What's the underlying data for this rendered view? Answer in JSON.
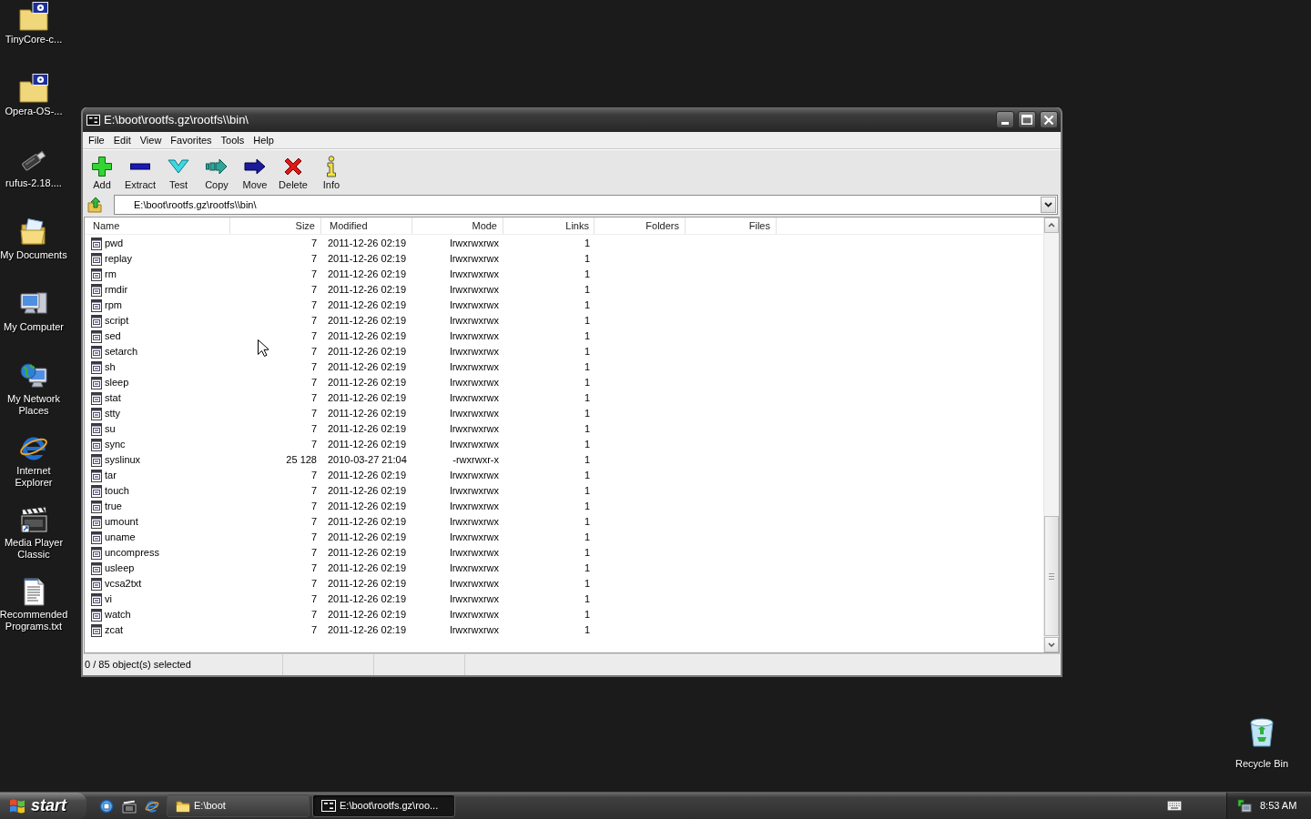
{
  "desktop": {
    "icons": [
      {
        "label": "TinyCore-c...",
        "kind": "iso"
      },
      {
        "label": "Opera-OS-...",
        "kind": "iso"
      },
      {
        "label": "rufus-2.18....",
        "kind": "usb"
      },
      {
        "label": "My Documents",
        "kind": "documents"
      },
      {
        "label": "My Computer",
        "kind": "computer"
      },
      {
        "label": "My Network Places",
        "kind": "network"
      },
      {
        "label": "Internet Explorer",
        "kind": "browser"
      },
      {
        "label": "Media Player Classic",
        "kind": "video"
      },
      {
        "label": "Recommended Programs.txt",
        "kind": "text"
      }
    ],
    "recycle_bin": {
      "label": "Recycle Bin"
    }
  },
  "window": {
    "title": "E:\\boot\\rootfs.gz\\rootfs\\\\bin\\",
    "menu": [
      "File",
      "Edit",
      "View",
      "Favorites",
      "Tools",
      "Help"
    ],
    "toolbar": [
      {
        "label": "Add",
        "kind": "add"
      },
      {
        "label": "Extract",
        "kind": "extract"
      },
      {
        "label": "Test",
        "kind": "test"
      },
      {
        "label": "Copy",
        "kind": "copy"
      },
      {
        "label": "Move",
        "kind": "move"
      },
      {
        "label": "Delete",
        "kind": "delete"
      },
      {
        "label": "Info",
        "kind": "info"
      }
    ],
    "address": {
      "value": "E:\\boot\\rootfs.gz\\rootfs\\\\bin\\"
    },
    "table": {
      "columns": [
        "Name",
        "Size",
        "Modified",
        "Mode",
        "Links",
        "Folders",
        "Files"
      ],
      "rows": [
        [
          "pwd",
          "7",
          "2011-12-26 02:19",
          "lrwxrwxrwx",
          "1"
        ],
        [
          "replay",
          "7",
          "2011-12-26 02:19",
          "lrwxrwxrwx",
          "1"
        ],
        [
          "rm",
          "7",
          "2011-12-26 02:19",
          "lrwxrwxrwx",
          "1"
        ],
        [
          "rmdir",
          "7",
          "2011-12-26 02:19",
          "lrwxrwxrwx",
          "1"
        ],
        [
          "rpm",
          "7",
          "2011-12-26 02:19",
          "lrwxrwxrwx",
          "1"
        ],
        [
          "script",
          "7",
          "2011-12-26 02:19",
          "lrwxrwxrwx",
          "1"
        ],
        [
          "sed",
          "7",
          "2011-12-26 02:19",
          "lrwxrwxrwx",
          "1"
        ],
        [
          "setarch",
          "7",
          "2011-12-26 02:19",
          "lrwxrwxrwx",
          "1"
        ],
        [
          "sh",
          "7",
          "2011-12-26 02:19",
          "lrwxrwxrwx",
          "1"
        ],
        [
          "sleep",
          "7",
          "2011-12-26 02:19",
          "lrwxrwxrwx",
          "1"
        ],
        [
          "stat",
          "7",
          "2011-12-26 02:19",
          "lrwxrwxrwx",
          "1"
        ],
        [
          "stty",
          "7",
          "2011-12-26 02:19",
          "lrwxrwxrwx",
          "1"
        ],
        [
          "su",
          "7",
          "2011-12-26 02:19",
          "lrwxrwxrwx",
          "1"
        ],
        [
          "sync",
          "7",
          "2011-12-26 02:19",
          "lrwxrwxrwx",
          "1"
        ],
        [
          "syslinux",
          "25 128",
          "2010-03-27 21:04",
          "-rwxrwxr-x",
          "1"
        ],
        [
          "tar",
          "7",
          "2011-12-26 02:19",
          "lrwxrwxrwx",
          "1"
        ],
        [
          "touch",
          "7",
          "2011-12-26 02:19",
          "lrwxrwxrwx",
          "1"
        ],
        [
          "true",
          "7",
          "2011-12-26 02:19",
          "lrwxrwxrwx",
          "1"
        ],
        [
          "umount",
          "7",
          "2011-12-26 02:19",
          "lrwxrwxrwx",
          "1"
        ],
        [
          "uname",
          "7",
          "2011-12-26 02:19",
          "lrwxrwxrwx",
          "1"
        ],
        [
          "uncompress",
          "7",
          "2011-12-26 02:19",
          "lrwxrwxrwx",
          "1"
        ],
        [
          "usleep",
          "7",
          "2011-12-26 02:19",
          "lrwxrwxrwx",
          "1"
        ],
        [
          "vcsa2txt",
          "7",
          "2011-12-26 02:19",
          "lrwxrwxrwx",
          "1"
        ],
        [
          "vi",
          "7",
          "2011-12-26 02:19",
          "lrwxrwxrwx",
          "1"
        ],
        [
          "watch",
          "7",
          "2011-12-26 02:19",
          "lrwxrwxrwx",
          "1"
        ],
        [
          "zcat",
          "7",
          "2011-12-26 02:19",
          "lrwxrwxrwx",
          "1"
        ]
      ]
    },
    "status_bar": {
      "text": "0 / 85 object(s) selected"
    }
  },
  "taskbar": {
    "start": "start",
    "tasks": [
      {
        "label": "E:\\boot",
        "kind": "folder",
        "selected": false
      },
      {
        "label": "E:\\boot\\rootfs.gz\\roo...",
        "kind": "archive",
        "selected": true
      }
    ],
    "clock": "8:53 AM"
  }
}
